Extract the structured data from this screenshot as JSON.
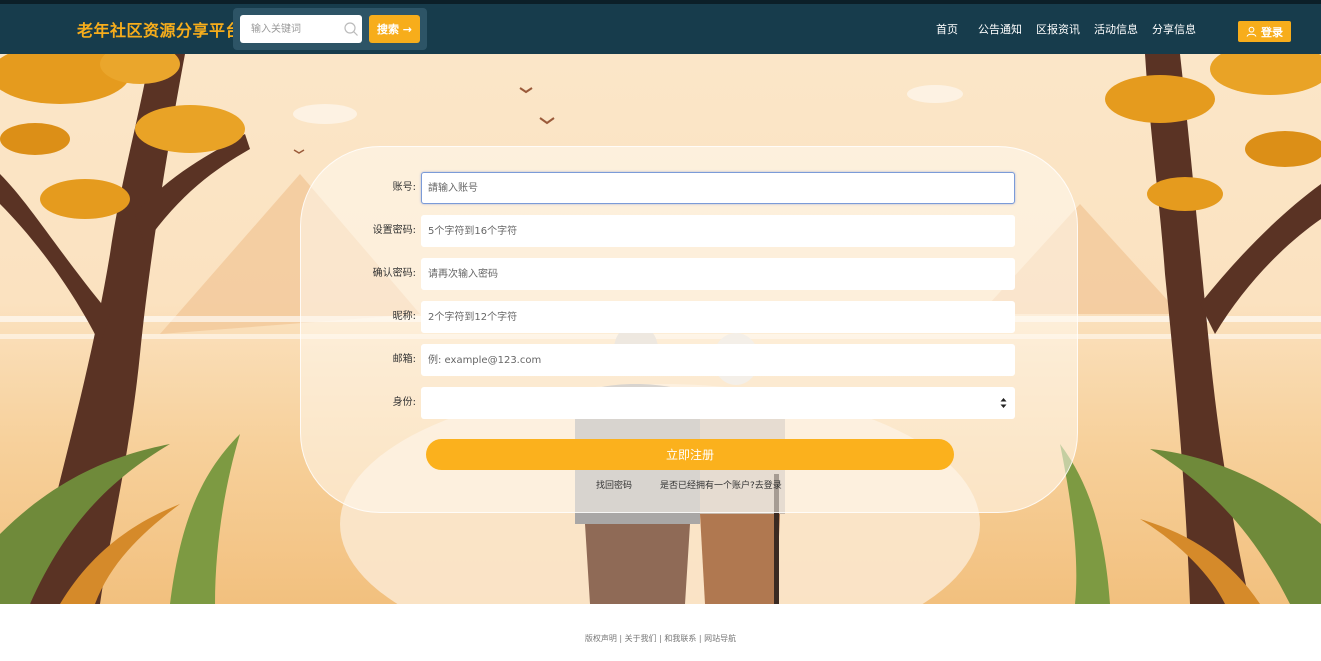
{
  "header": {
    "brand": "老年社区资源分享平台",
    "search_placeholder": "输入关键词",
    "search_label": "搜索 →",
    "nav": [
      "首页",
      "公告通知",
      "区报资讯",
      "活动信息",
      "分享信息"
    ],
    "login_label": "登录"
  },
  "form": {
    "fields": [
      {
        "label": "账号:",
        "placeholder": "請输入账号"
      },
      {
        "label": "设置密码:",
        "placeholder": "5个字符到16个字符"
      },
      {
        "label": "确认密码:",
        "placeholder": "请再次输入密码"
      },
      {
        "label": "昵称:",
        "placeholder": "2个字符到12个字符"
      },
      {
        "label": "邮箱:",
        "placeholder": "例: example@123.com"
      },
      {
        "label": "身份:",
        "value": ""
      }
    ],
    "submit_label": "立即注册",
    "forgot_link": "找回密码",
    "login_link": "是否已经拥有一个账户?去登录"
  },
  "footer": {
    "text": "版权声明 | 关于我们 | 和我联系 | 网站导航"
  },
  "colors": {
    "header_bg": "#173c4c",
    "accent": "#f7ad1b"
  }
}
